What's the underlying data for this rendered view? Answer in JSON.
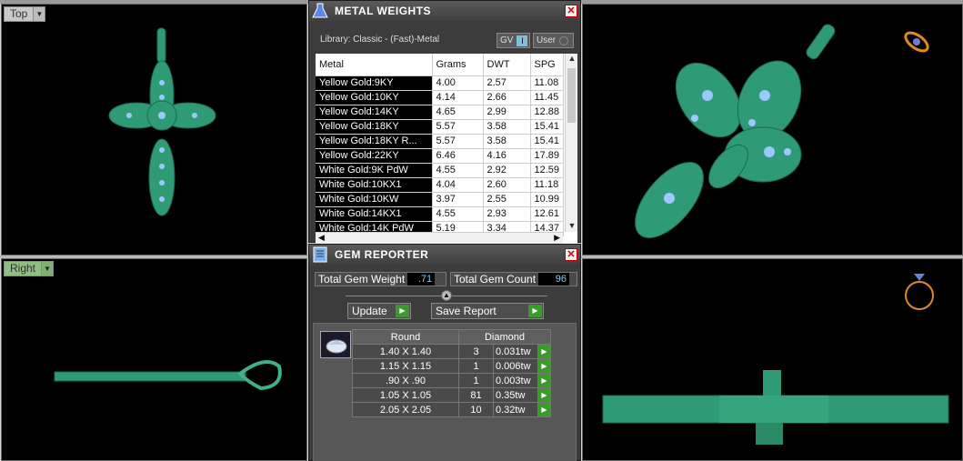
{
  "viewports": {
    "top_label": "Top",
    "right_label": "Right"
  },
  "metal_weights": {
    "title": "METAL WEIGHTS",
    "library": "Library: Classic - (Fast)-Metal",
    "toggle_gv": "GV",
    "toggle_gv_value": "I",
    "toggle_user": "User",
    "columns": [
      "Metal",
      "Grams",
      "DWT",
      "SPG"
    ],
    "rows": [
      [
        "Yellow Gold:9KY",
        "4.00",
        "2.57",
        "11.08"
      ],
      [
        "Yellow Gold:10KY",
        "4.14",
        "2.66",
        "11.45"
      ],
      [
        "Yellow Gold:14KY",
        "4.65",
        "2.99",
        "12.88"
      ],
      [
        "Yellow Gold:18KY",
        "5.57",
        "3.58",
        "15.41"
      ],
      [
        "Yellow Gold:18KY R...",
        "5.57",
        "3.58",
        "15.41"
      ],
      [
        "Yellow Gold:22KY",
        "6.46",
        "4.16",
        "17.89"
      ],
      [
        "White Gold:9K PdW",
        "4.55",
        "2.92",
        "12.59"
      ],
      [
        "White Gold:10KX1",
        "4.04",
        "2.60",
        "11.18"
      ],
      [
        "White Gold:10KW",
        "3.97",
        "2.55",
        "10.99"
      ],
      [
        "White Gold:14KX1",
        "4.55",
        "2.93",
        "12.61"
      ],
      [
        "White Gold:14K PdW",
        "5.19",
        "3.34",
        "14.37"
      ]
    ]
  },
  "gem_reporter": {
    "title": "GEM REPORTER",
    "total_weight_label": "Total Gem Weight",
    "total_weight_value": ".71",
    "total_count_label": "Total Gem Count",
    "total_count_value": "96",
    "update_label": "Update",
    "save_label": "Save Report",
    "shape_header": "Round",
    "material_header": "Diamond",
    "gems": [
      {
        "size": "1.40 X 1.40",
        "qty": "3",
        "tw": "0.031tw"
      },
      {
        "size": "1.15 X 1.15",
        "qty": "1",
        "tw": "0.006tw"
      },
      {
        "size": ".90 X .90",
        "qty": "1",
        "tw": "0.003tw"
      },
      {
        "size": "1.05 X 1.05",
        "qty": "81",
        "tw": "0.35tw"
      },
      {
        "size": "2.05 X 2.05",
        "qty": "10",
        "tw": "0.32tw"
      }
    ]
  },
  "colors": {
    "metal_green": "#2f9a76",
    "gem_blue": "#9ec6ff",
    "accent_go": "#3a9a2a"
  }
}
